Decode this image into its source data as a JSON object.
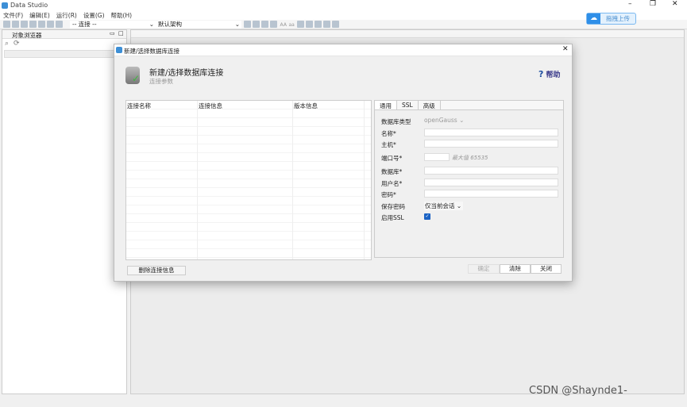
{
  "app": {
    "title": "Data Studio",
    "upload_label": "拖拽上传"
  },
  "menu": [
    "文件(F)",
    "编辑(E)",
    "运行(R)",
    "设置(G)",
    "帮助(H)"
  ],
  "toolbar": {
    "connection": "-- 连接 --",
    "schema": "默认架构",
    "font_aa": "AA",
    "font_aa2": "aa"
  },
  "left_panel": {
    "tab": "对象浏览器"
  },
  "dialog": {
    "title": "新建/选择数据库连接",
    "heading": "新建/选择数据库连接",
    "subheading": "连接参数",
    "help": "帮助",
    "table_headers": [
      "连接名称",
      "连接信息",
      "版本信息"
    ],
    "tabs": [
      "通用",
      "SSL",
      "高级"
    ],
    "fields": {
      "db_type_label": "数据库类型",
      "db_type_value": "openGauss",
      "name_label": "名称*",
      "host_label": "主机*",
      "port_label": "端口号*",
      "port_hint": "最大值 65535",
      "database_label": "数据库*",
      "user_label": "用户名*",
      "password_label": "密码*",
      "save_password_label": "保存密码",
      "save_password_value": "仅当前会话",
      "ssl_label": "启用SSL",
      "ssl_checked": true
    },
    "buttons": {
      "delete": "删除连接信息",
      "ok": "确定",
      "clear": "清除",
      "close": "关闭"
    }
  },
  "watermark": "CSDN @Shaynde1-"
}
